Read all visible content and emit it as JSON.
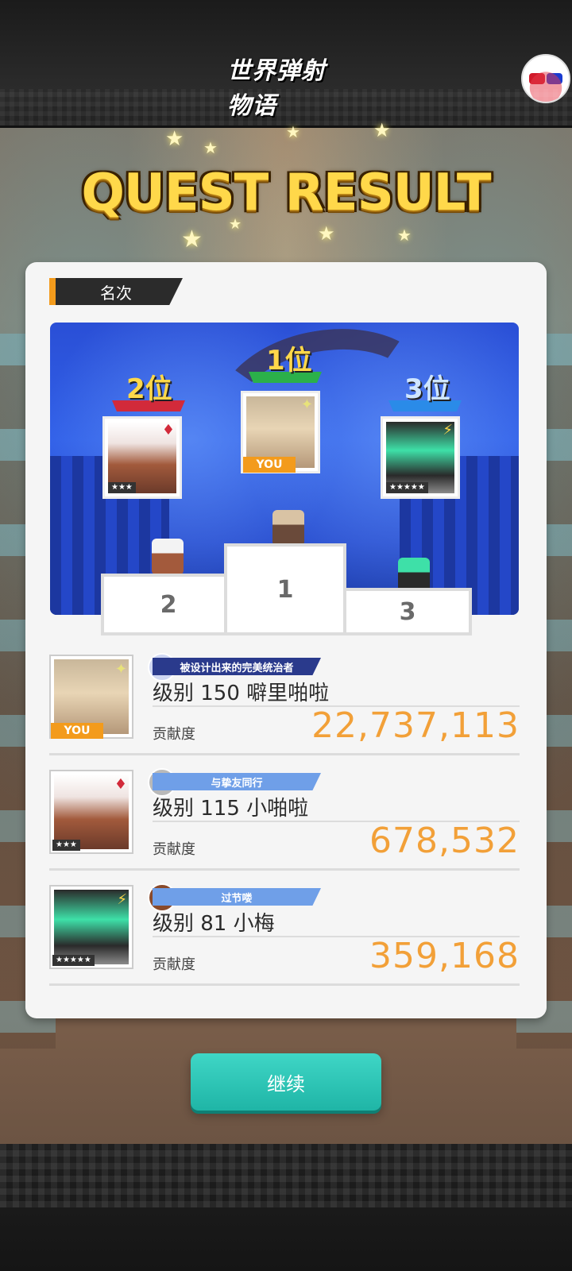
{
  "app": {
    "logo_text": "世界弹射物语",
    "page_title": "QUEST RESULT"
  },
  "section": {
    "tag_label": "名次"
  },
  "podium": {
    "rank1_label": "1位",
    "rank2_label": "2位",
    "rank3_label": "3位",
    "you_label": "YOU",
    "step1": "1",
    "step2": "2",
    "step3": "3",
    "rarity2": "★★★",
    "rarity3": "★★★★★"
  },
  "players": [
    {
      "title_badge": "被设计出来的完美统治者",
      "level_name": "级别 150 噼里啪啦",
      "contrib_label": "贡献度",
      "score": "22,737,113",
      "you_label": "YOU"
    },
    {
      "title_badge": "与挚友同行",
      "level_name": "级别 115 小啪啦",
      "contrib_label": "贡献度",
      "score": "678,532",
      "rarity": "★★★"
    },
    {
      "title_badge": "过节喽",
      "level_name": "级别 81 小梅",
      "contrib_label": "贡献度",
      "score": "359,168",
      "rarity": "★★★★★"
    }
  ],
  "buttons": {
    "continue": "继续"
  },
  "colors": {
    "accent_orange": "#f39b1c",
    "score_orange": "#f2a038",
    "continue_teal": "#2ac3b3",
    "title_gold": "#ffd84a"
  }
}
